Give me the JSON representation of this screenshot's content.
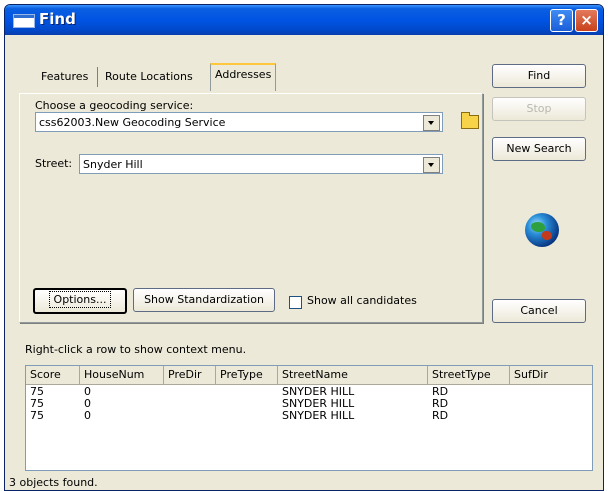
{
  "window": {
    "title": "Find"
  },
  "titlebar": {
    "help_glyph": "?",
    "close_glyph": "×"
  },
  "tabs": [
    {
      "label": "Features",
      "active": false
    },
    {
      "label": "Route Locations",
      "active": false
    },
    {
      "label": "Addresses",
      "active": true
    }
  ],
  "geocode": {
    "service_label": "Choose a geocoding service:",
    "service_value": "css62003.New Geocoding Service",
    "street_label": "Street:",
    "street_value": "Snyder Hill"
  },
  "buttons": {
    "find": "Find",
    "stop": "Stop",
    "new_search": "New Search",
    "cancel": "Cancel",
    "options": "Options...",
    "show_standardization": "Show Standardization"
  },
  "checkbox": {
    "label": "Show all candidates",
    "checked": false
  },
  "results": {
    "hint": "Right-click a row to show context menu.",
    "columns": [
      "Score",
      "HouseNum",
      "PreDir",
      "PreType",
      "StreetName",
      "StreetType",
      "SufDir"
    ],
    "rows": [
      [
        "75",
        "0",
        "",
        "",
        "SNYDER HILL",
        "RD",
        ""
      ],
      [
        "75",
        "0",
        "",
        "",
        "SNYDER HILL",
        "RD",
        ""
      ],
      [
        "75",
        "0",
        "",
        "",
        "SNYDER HILL",
        "RD",
        ""
      ]
    ]
  },
  "status": "3 objects found.",
  "icons": {
    "window": "window-icon",
    "browse": "folder-open-icon",
    "globe": "globe-icon"
  },
  "colors": {
    "titlebar": "#0054e3",
    "dialog": "#ece9d8",
    "active_tab_accent": "#ffc83c"
  }
}
